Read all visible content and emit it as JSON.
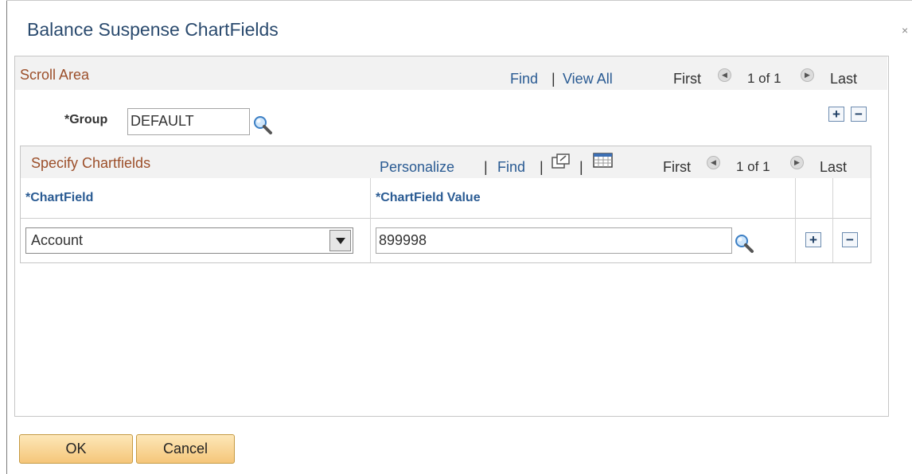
{
  "dialog": {
    "title": "Balance Suspense ChartFields",
    "close_label": "×"
  },
  "scroll_area": {
    "title": "Scroll Area",
    "find": "Find",
    "separator": "|",
    "view_all": "View All",
    "first": "First",
    "count": "1 of 1",
    "last": "Last"
  },
  "group": {
    "label": "*Group",
    "value": "DEFAULT"
  },
  "grid": {
    "title": "Specify Chartfields",
    "personalize": "Personalize",
    "separator": "|",
    "find": "Find",
    "first": "First",
    "count": "1 of 1",
    "last": "Last",
    "columns": [
      "*ChartField",
      "*ChartField Value"
    ],
    "rows": [
      {
        "chartfield": "Account",
        "value": "899998"
      }
    ]
  },
  "buttons": {
    "ok": "OK",
    "cancel": "Cancel"
  },
  "icons": {
    "lookup": "magnifier-icon",
    "add": "plus-icon",
    "delete": "minus-icon",
    "prev": "left-arrow-icon",
    "next": "right-arrow-icon",
    "new_window": "new-window-icon",
    "download": "spreadsheet-icon",
    "dropdown": "dropdown-arrow-icon"
  },
  "colors": {
    "title_text": "#2a4a6e",
    "section_title": "#9c4f2a",
    "link": "#2a5b93",
    "button_fill": "#f5c67a"
  }
}
